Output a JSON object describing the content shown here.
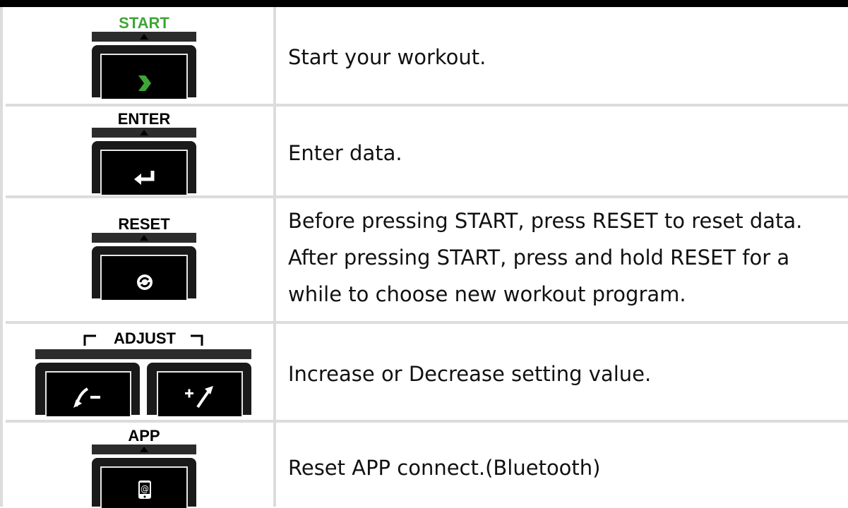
{
  "rows": [
    {
      "button": "START",
      "button_color": "#3ea637",
      "description_lines": [
        "Start your workout."
      ]
    },
    {
      "button": "ENTER",
      "button_color": "#000000",
      "description_lines": [
        "Enter data."
      ]
    },
    {
      "button": "RESET",
      "button_color": "#000000",
      "description_lines": [
        "Before pressing START, press RESET to reset data.",
        "After pressing START, press and hold RESET for a",
        "while to choose new workout program."
      ]
    },
    {
      "button": "ADJUST",
      "button_color": "#000000",
      "description_lines": [
        "Increase or Decrease setting value."
      ]
    },
    {
      "button": "APP",
      "button_color": "#000000",
      "description_lines": [
        "Reset APP connect.(Bluetooth)"
      ]
    }
  ],
  "icons": [
    "play-icon",
    "enter-icon",
    "reset-icon",
    "decrease-icon",
    "increase-icon",
    "app-icon"
  ],
  "colors": {
    "accent_green": "#3ea637",
    "border": "#dcdcdc",
    "header": "#000000"
  }
}
